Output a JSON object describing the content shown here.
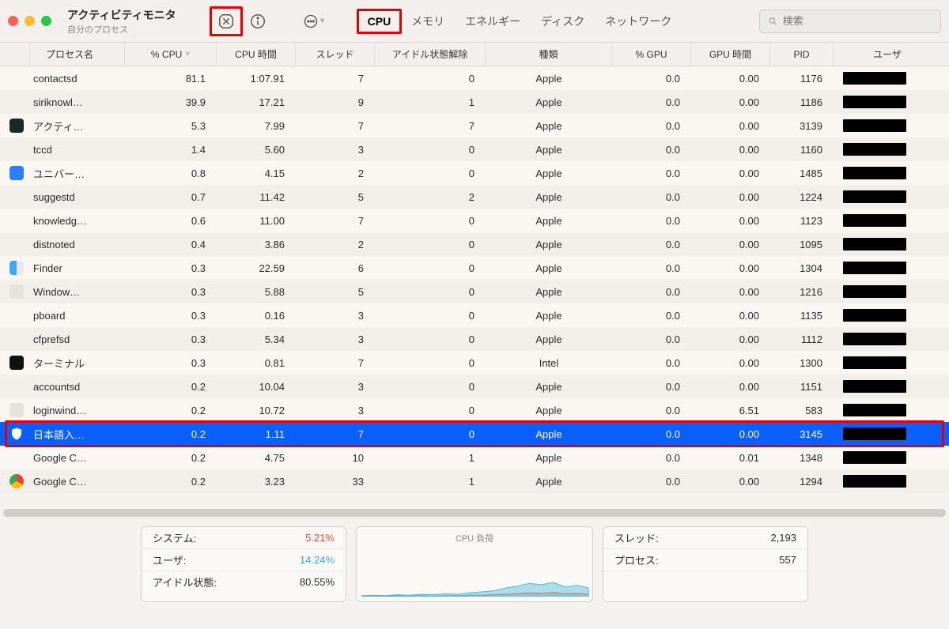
{
  "window": {
    "title": "アクティビティモニタ",
    "subtitle": "自分のプロセス"
  },
  "search": {
    "placeholder": "検索"
  },
  "filters": {
    "cpu": "CPU",
    "memory": "メモリ",
    "energy": "エネルギー",
    "disk": "ディスク",
    "network": "ネットワーク"
  },
  "columns": {
    "name": "プロセス名",
    "cpu": "% CPU",
    "cputime": "CPU 時間",
    "threads": "スレッド",
    "idle": "アイドル状態解除",
    "kind": "種類",
    "gpu": "% GPU",
    "gputime": "GPU 時間",
    "pid": "PID",
    "user": "ユーザ"
  },
  "rows": [
    {
      "icon": "",
      "name": "contactsd",
      "cpu": "81.1",
      "cputime": "1:07.91",
      "threads": "7",
      "idle": "0",
      "kind": "Apple",
      "gpu": "0.0",
      "gputime": "0.00",
      "pid": "1176"
    },
    {
      "icon": "",
      "name": "siriknowl…",
      "cpu": "39.9",
      "cputime": "17.21",
      "threads": "9",
      "idle": "1",
      "kind": "Apple",
      "gpu": "0.0",
      "gputime": "0.00",
      "pid": "1186"
    },
    {
      "icon": "activity",
      "name": "アクティ…",
      "cpu": "5.3",
      "cputime": "7.99",
      "threads": "7",
      "idle": "7",
      "kind": "Apple",
      "gpu": "0.0",
      "gputime": "0.00",
      "pid": "3139"
    },
    {
      "icon": "",
      "name": "tccd",
      "cpu": "1.4",
      "cputime": "5.60",
      "threads": "3",
      "idle": "0",
      "kind": "Apple",
      "gpu": "0.0",
      "gputime": "0.00",
      "pid": "1160"
    },
    {
      "icon": "universal",
      "name": "ユニバー…",
      "cpu": "0.8",
      "cputime": "4.15",
      "threads": "2",
      "idle": "0",
      "kind": "Apple",
      "gpu": "0.0",
      "gputime": "0.00",
      "pid": "1485"
    },
    {
      "icon": "",
      "name": "suggestd",
      "cpu": "0.7",
      "cputime": "11.42",
      "threads": "5",
      "idle": "2",
      "kind": "Apple",
      "gpu": "0.0",
      "gputime": "0.00",
      "pid": "1224"
    },
    {
      "icon": "",
      "name": "knowledg…",
      "cpu": "0.6",
      "cputime": "11.00",
      "threads": "7",
      "idle": "0",
      "kind": "Apple",
      "gpu": "0.0",
      "gputime": "0.00",
      "pid": "1123"
    },
    {
      "icon": "",
      "name": "distnoted",
      "cpu": "0.4",
      "cputime": "3.86",
      "threads": "2",
      "idle": "0",
      "kind": "Apple",
      "gpu": "0.0",
      "gputime": "0.00",
      "pid": "1095"
    },
    {
      "icon": "finder",
      "name": "Finder",
      "cpu": "0.3",
      "cputime": "22.59",
      "threads": "6",
      "idle": "0",
      "kind": "Apple",
      "gpu": "0.0",
      "gputime": "0.00",
      "pid": "1304"
    },
    {
      "icon": "generic",
      "name": "Window…",
      "cpu": "0.3",
      "cputime": "5.88",
      "threads": "5",
      "idle": "0",
      "kind": "Apple",
      "gpu": "0.0",
      "gputime": "0.00",
      "pid": "1216"
    },
    {
      "icon": "",
      "name": "pboard",
      "cpu": "0.3",
      "cputime": "0.16",
      "threads": "3",
      "idle": "0",
      "kind": "Apple",
      "gpu": "0.0",
      "gputime": "0.00",
      "pid": "1135"
    },
    {
      "icon": "",
      "name": "cfprefsd",
      "cpu": "0.3",
      "cputime": "5.34",
      "threads": "3",
      "idle": "0",
      "kind": "Apple",
      "gpu": "0.0",
      "gputime": "0.00",
      "pid": "1112"
    },
    {
      "icon": "terminal",
      "name": "ターミナル",
      "cpu": "0.3",
      "cputime": "0.81",
      "threads": "7",
      "idle": "0",
      "kind": "Intel",
      "gpu": "0.0",
      "gputime": "0.00",
      "pid": "1300"
    },
    {
      "icon": "",
      "name": "accountsd",
      "cpu": "0.2",
      "cputime": "10.04",
      "threads": "3",
      "idle": "0",
      "kind": "Apple",
      "gpu": "0.0",
      "gputime": "0.00",
      "pid": "1151"
    },
    {
      "icon": "generic",
      "name": "loginwind…",
      "cpu": "0.2",
      "cputime": "10.72",
      "threads": "3",
      "idle": "0",
      "kind": "Apple",
      "gpu": "0.0",
      "gputime": "6.51",
      "pid": "583"
    },
    {
      "icon": "shield",
      "name": "日本語入…",
      "cpu": "0.2",
      "cputime": "1.11",
      "threads": "7",
      "idle": "0",
      "kind": "Apple",
      "gpu": "0.0",
      "gputime": "0.00",
      "pid": "3145",
      "selected": true
    },
    {
      "icon": "",
      "name": "Google C…",
      "cpu": "0.2",
      "cputime": "4.75",
      "threads": "10",
      "idle": "1",
      "kind": "Apple",
      "gpu": "0.0",
      "gputime": "0.01",
      "pid": "1348"
    },
    {
      "icon": "chrome",
      "name": "Google C…",
      "cpu": "0.2",
      "cputime": "3.23",
      "threads": "33",
      "idle": "1",
      "kind": "Apple",
      "gpu": "0.0",
      "gputime": "0.00",
      "pid": "1294"
    }
  ],
  "summary": {
    "left": {
      "system_label": "システム:",
      "system_val": "5.21%",
      "user_label": "ユーザ:",
      "user_val": "14.24%",
      "idle_label": "アイドル状態:",
      "idle_val": "80.55%"
    },
    "mid_title": "CPU 負荷",
    "right": {
      "threads_label": "スレッド:",
      "threads_val": "2,193",
      "procs_label": "プロセス:",
      "procs_val": "557"
    }
  },
  "chart_data": {
    "type": "area",
    "title": "CPU 負荷",
    "x": [
      0,
      1,
      2,
      3,
      4,
      5,
      6,
      7,
      8,
      9,
      10,
      11,
      12,
      13,
      14,
      15,
      16,
      17,
      18,
      19
    ],
    "series": [
      {
        "name": "ユーザ",
        "color": "#4fb8d6",
        "values": [
          2,
          3,
          2,
          4,
          3,
          5,
          4,
          6,
          5,
          8,
          10,
          12,
          18,
          22,
          28,
          25,
          30,
          20,
          24,
          18
        ]
      },
      {
        "name": "システム",
        "color": "#e06b5a",
        "values": [
          1,
          1,
          1,
          2,
          1,
          2,
          1,
          2,
          2,
          3,
          3,
          4,
          5,
          6,
          8,
          7,
          9,
          6,
          7,
          5
        ]
      }
    ],
    "ylim": [
      0,
      100
    ]
  }
}
